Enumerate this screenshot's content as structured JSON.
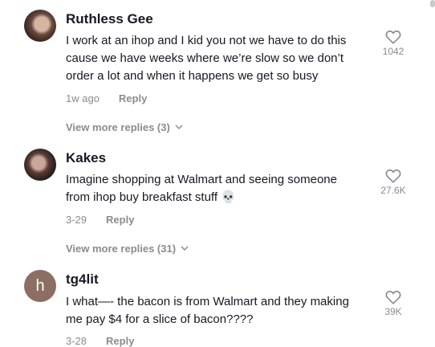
{
  "comments": [
    {
      "username": "Ruthless Gee",
      "text_lines": [
        "I work at an ihop and I kid you not we have to do this",
        "cause we have weeks where we’re slow so we don’t",
        "order a lot and when it happens we get so busy"
      ],
      "time": "1w ago",
      "reply_label": "Reply",
      "likes": "1042",
      "view_more": "View more replies (3)",
      "avatar_icon": "user-photo-avatar"
    },
    {
      "username": "Kakes",
      "text_lines": [
        "Imagine shopping at Walmart and seeing someone",
        "from ihop buy breakfast stuff 💀"
      ],
      "time": "3-29",
      "reply_label": "Reply",
      "likes": "27.6K",
      "view_more": "View more replies (31)",
      "avatar_icon": "user-photo-avatar"
    },
    {
      "username": "tg4lit",
      "avatar_letter": "h",
      "text_lines": [
        "I what—- the bacon is from Walmart and they making",
        "me pay $4 for a slice of bacon????"
      ],
      "time": "3-28",
      "reply_label": "Reply",
      "likes": "39K"
    }
  ],
  "icons": {
    "like": "heart-outline-icon",
    "expand": "chevron-down-icon"
  },
  "colors": {
    "text": "#161823",
    "muted": "#8a8b91",
    "letter_avatar": "#8d6e63"
  }
}
